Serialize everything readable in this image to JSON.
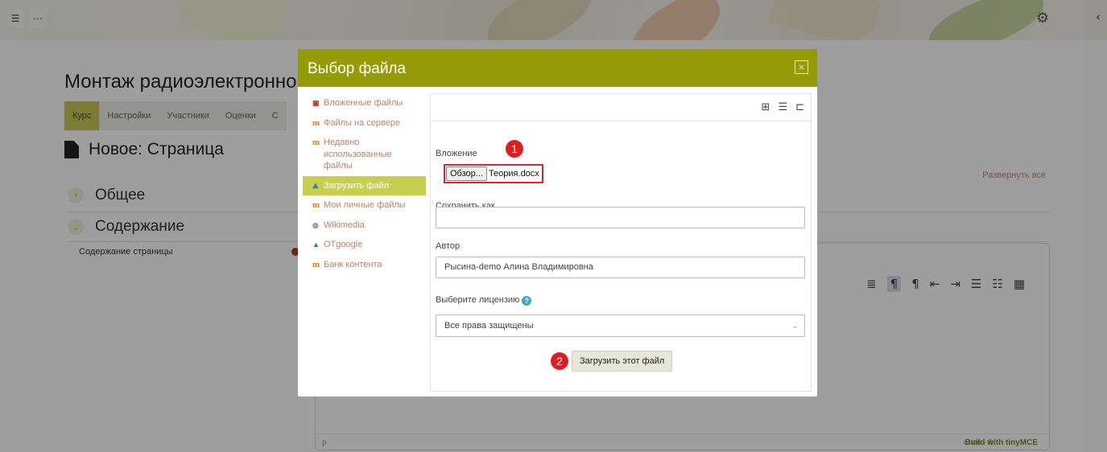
{
  "topbar": {
    "drawer_icon": "list-icon",
    "more_icon": "ellipsis-icon",
    "gear_icon": "gear-icon",
    "collapse_icon": "chevron-left-icon"
  },
  "course": {
    "title": "Монтаж радиоэлектронной",
    "tabs": [
      "Курс",
      "Настройки",
      "Участники",
      "Оценки",
      "С"
    ],
    "page_heading": "Новое: Страница",
    "expand_all": "Развернуть всё",
    "sections": [
      {
        "label": "Общее",
        "state": "collapsed"
      },
      {
        "label": "Содержание",
        "state": "expanded"
      }
    ],
    "field_label": "Содержание страницы",
    "editor": {
      "status_path": "p",
      "word_count": "слов - 0",
      "build_with": "Build with tinyMCE"
    }
  },
  "modal": {
    "title": "Выбор файла",
    "close_symbol": "×",
    "repositories": [
      {
        "label": "Вложенные файлы",
        "icon": "file-icon",
        "active": false
      },
      {
        "label": "Файлы на сервере",
        "icon": "moodle-icon",
        "active": false
      },
      {
        "label": "Недавно использованные файлы",
        "icon": "moodle-icon",
        "active": false
      },
      {
        "label": "Загрузить файл",
        "icon": "upload-icon",
        "active": true
      },
      {
        "label": "Мои личные файлы",
        "icon": "moodle-icon",
        "active": false
      },
      {
        "label": "Wikimedia",
        "icon": "wikimedia-icon",
        "active": false
      },
      {
        "label": "OTgoogle",
        "icon": "google-drive-icon",
        "active": false
      },
      {
        "label": "Банк контента",
        "icon": "moodle-icon",
        "active": false
      }
    ],
    "form": {
      "attachment_label": "Вложение",
      "browse_label": "Обзор...",
      "file_name": "Теория.docx",
      "save_as_label": "Сохранить как",
      "save_as_value": "",
      "author_label": "Автор",
      "author_value": "Рысина-demo Алина Владимировна",
      "license_label": "Выберите лицензию",
      "license_value": "Все права защищены",
      "upload_button": "Загрузить этот файл"
    },
    "markers": [
      "1",
      "2"
    ]
  },
  "colors": {
    "header": "#959b05",
    "active_repo": "#c8cf4e",
    "marker": "#e01e21",
    "link": "#b8826a"
  }
}
